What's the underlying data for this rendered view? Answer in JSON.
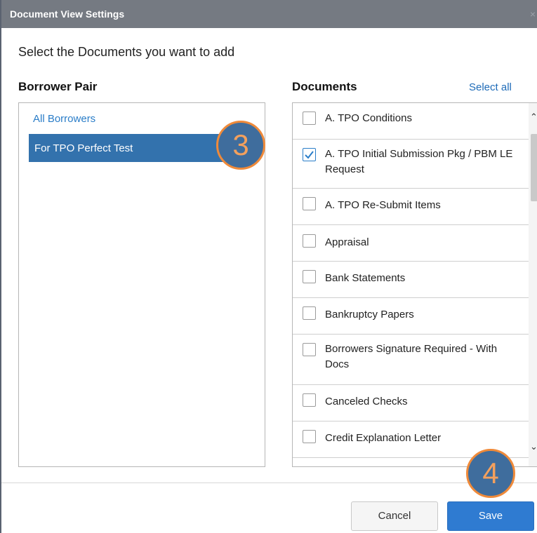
{
  "dialog": {
    "title": "Document View Settings",
    "close": "×",
    "subtitle": "Select the Documents you want to add"
  },
  "borrower_pair": {
    "heading": "Borrower Pair",
    "items": [
      {
        "label": "All Borrowers",
        "selected": false
      },
      {
        "label": "For TPO Perfect Test",
        "selected": true
      }
    ]
  },
  "documents": {
    "heading": "Documents",
    "select_all": "Select all",
    "items": [
      {
        "label": "A. TPO Conditions",
        "checked": false
      },
      {
        "label": "A. TPO Initial Submission Pkg / PBM LE Request",
        "checked": true
      },
      {
        "label": "A. TPO Re-Submit Items",
        "checked": false
      },
      {
        "label": "Appraisal",
        "checked": false
      },
      {
        "label": "Bank Statements",
        "checked": false
      },
      {
        "label": "Bankruptcy Papers",
        "checked": false
      },
      {
        "label": "Borrowers Signature Required - With Docs",
        "checked": false
      },
      {
        "label": "Canceled Checks",
        "checked": false
      },
      {
        "label": "Credit Explanation Letter",
        "checked": false
      },
      {
        "label": "",
        "checked": false
      }
    ],
    "scroll_up": "⌃",
    "scroll_down": "⌄"
  },
  "callouts": [
    "3",
    "4"
  ],
  "footer": {
    "cancel_label": "Cancel",
    "save_label": "Save"
  },
  "colors": {
    "titlebar": "#757a82",
    "accent": "#2f7bd1",
    "selected_row": "#3372ad",
    "callout_fill": "#3f6d9d",
    "callout_border": "#ef8a3a"
  }
}
